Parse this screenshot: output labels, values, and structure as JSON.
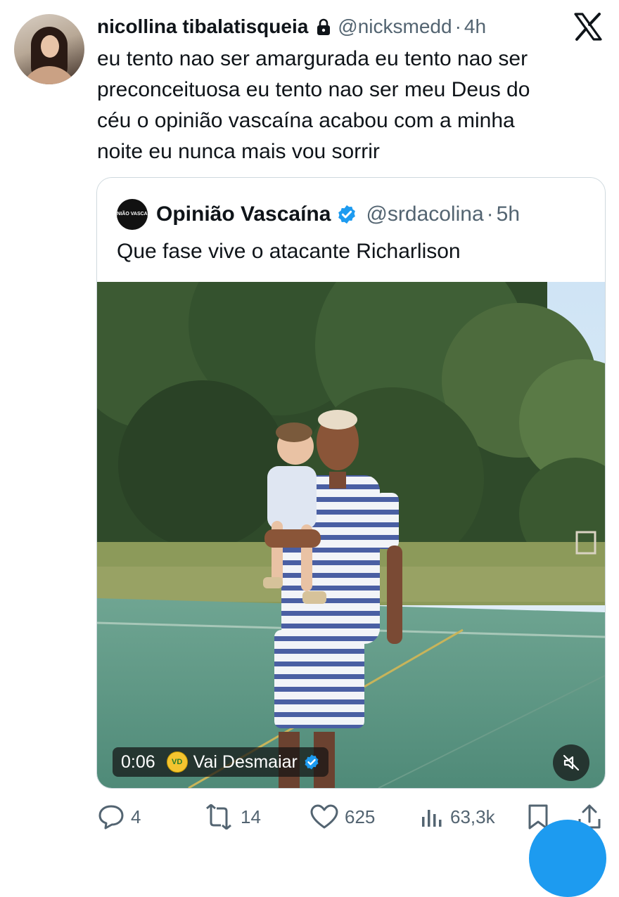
{
  "author": {
    "name": "nicollina tibalatisqueia",
    "handle": "@nicksmedd",
    "separator": "·",
    "time": "4h",
    "locked": true,
    "avatar_icon": "profile-photo"
  },
  "platform_icon": "x-logo",
  "tweet": {
    "lines": [
      "eu tento nao ser amargurada eu tento nao ser",
      "preconceituosa eu tento nao ser meu Deus do",
      "céu o opinião vascaína acabou com a minha",
      "noite eu nunca mais vou sorrir"
    ]
  },
  "quoted": {
    "name": "Opinião Vascaína",
    "handle": "@srdacolina",
    "separator": "·",
    "time": "5h",
    "verified": true,
    "avatar_text": "OPINIÃO VASCAÍNA",
    "text": "Que fase vive o atacante Richarlison",
    "video": {
      "timestamp": "0:06",
      "source_logo_text": "VD",
      "source_name": "Vai Desmaiar",
      "source_verified": true,
      "mute_icon": "speaker-muted-icon"
    }
  },
  "actions": {
    "replies": "4",
    "reposts": "14",
    "likes": "625",
    "views": "63,3k"
  },
  "colors": {
    "text": "#0f1419",
    "secondary": "#536471",
    "verified_blue": "#1d9bf0",
    "border": "#cfd9de"
  }
}
